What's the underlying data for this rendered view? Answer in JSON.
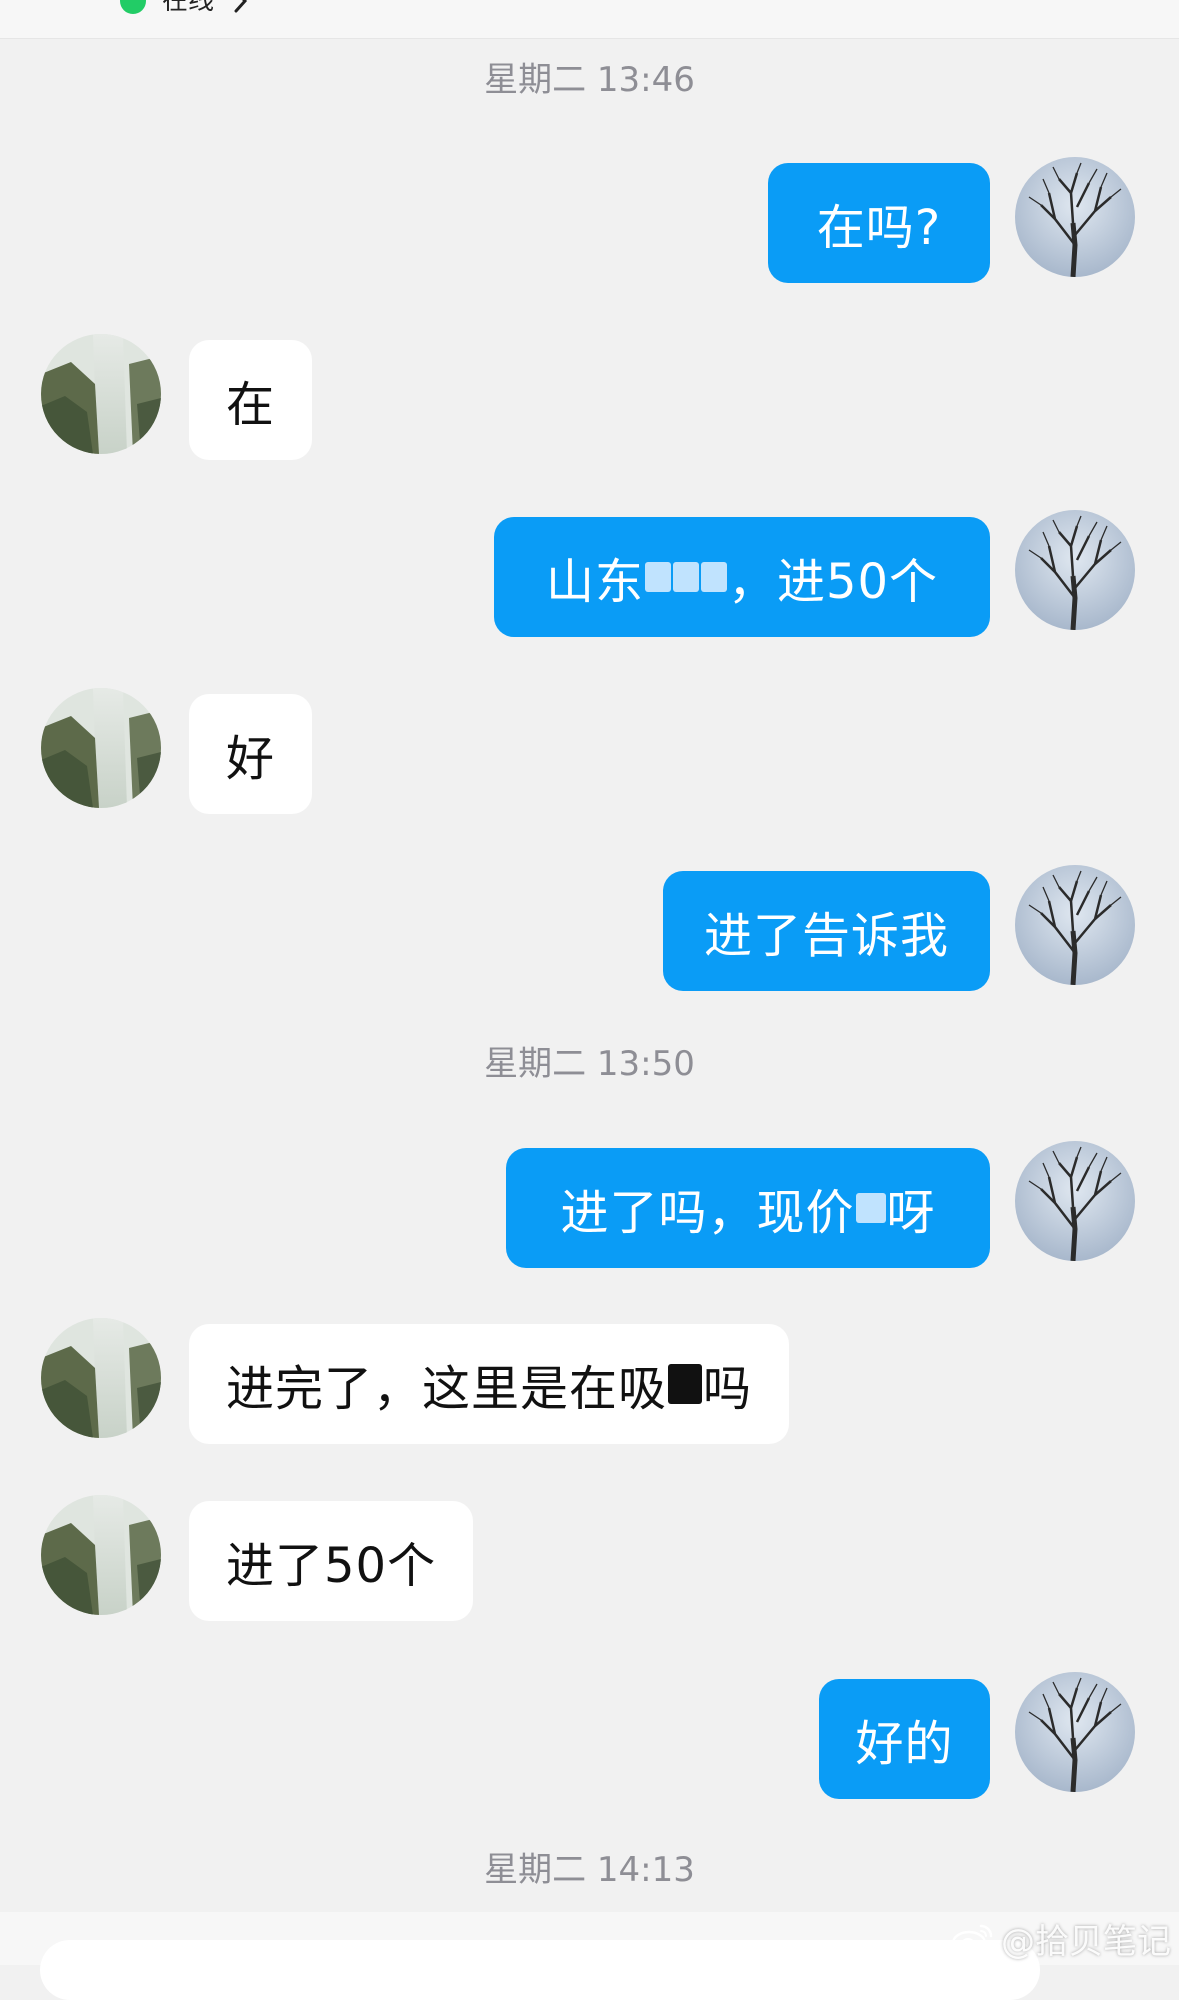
{
  "header": {
    "status": "在线"
  },
  "timestamps": [
    "星期二 13:46",
    "星期二 13:50",
    "星期二 14:13"
  ],
  "messages": [
    {
      "side": "out",
      "text": "在吗?"
    },
    {
      "side": "in",
      "text": "在"
    },
    {
      "side": "out",
      "parts": [
        "山东",
        "，进50个"
      ]
    },
    {
      "side": "in",
      "text": "好"
    },
    {
      "side": "out",
      "text": "进了告诉我"
    },
    {
      "side": "out",
      "parts": [
        "进了吗，现价",
        "呀"
      ]
    },
    {
      "side": "in",
      "parts": [
        "进完了，这里是在吸",
        "吗"
      ]
    },
    {
      "side": "in",
      "text": "进了50个"
    },
    {
      "side": "out",
      "text": "好的"
    }
  ],
  "watermark": {
    "text": "@拾贝笔记",
    "icon": "weibo-icon"
  },
  "colors": {
    "outgoing_bubble": "#0a9cf6",
    "incoming_bubble": "#ffffff",
    "background": "#f1f1f1",
    "online_status": "#22cc66"
  }
}
